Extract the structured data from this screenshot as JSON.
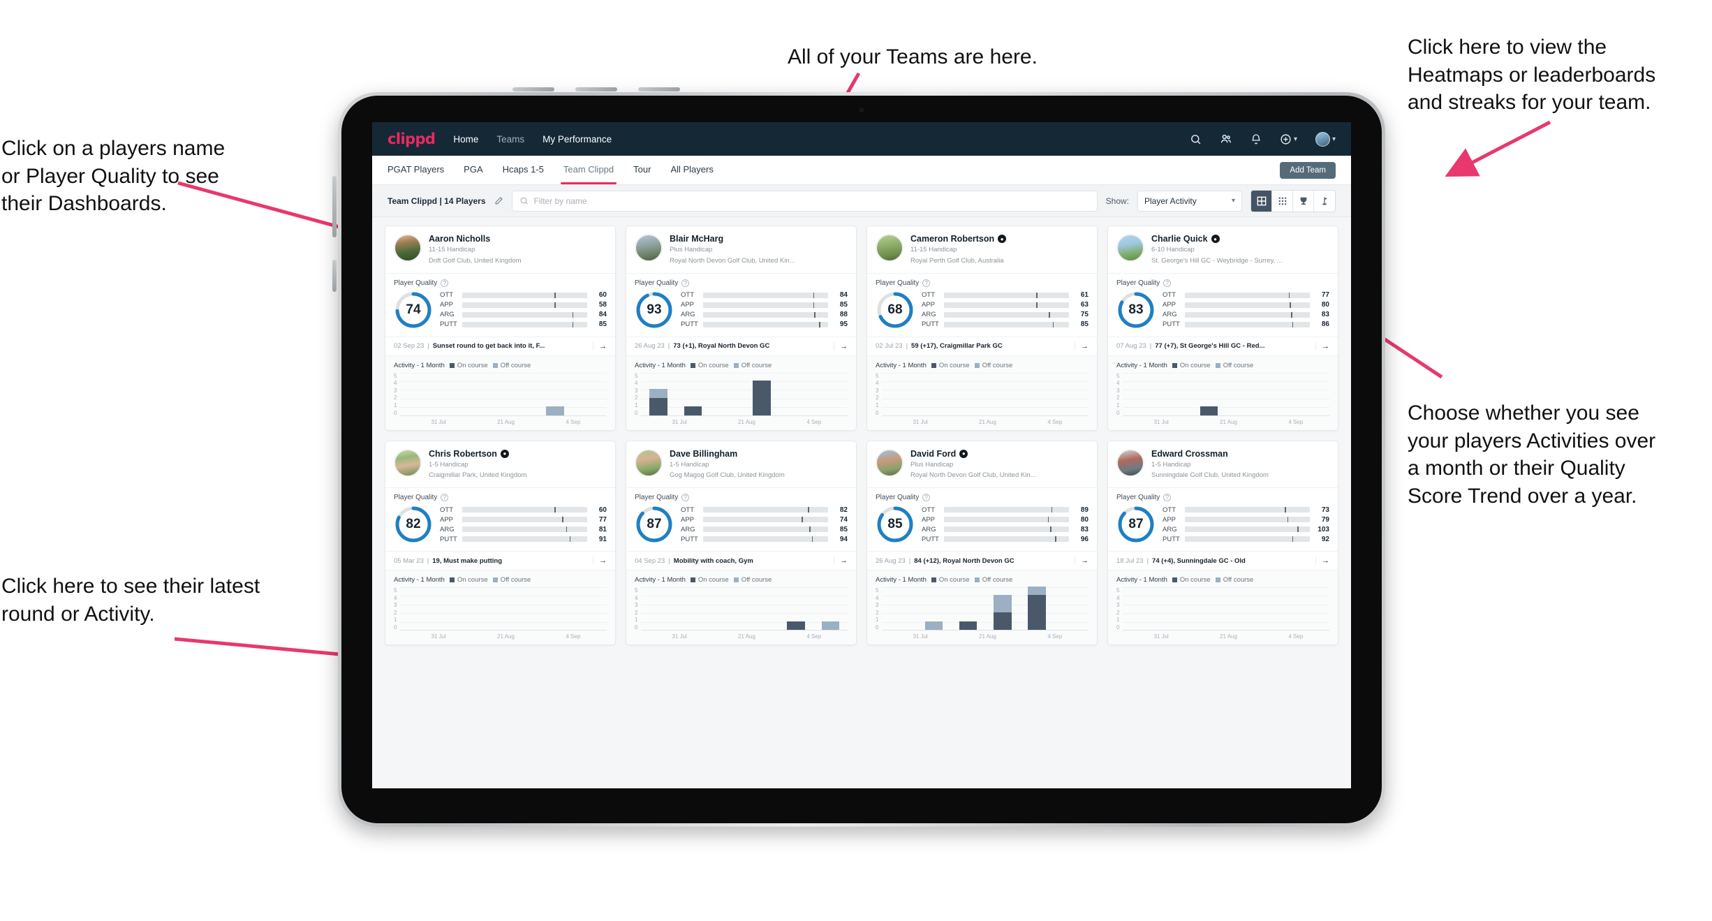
{
  "annotations": [
    {
      "id": "players-name",
      "text": "Click on a players name\nor Player Quality to see\ntheir Dashboards."
    },
    {
      "id": "teams-here",
      "text": "All of your Teams are here."
    },
    {
      "id": "heatmaps",
      "text": "Click here to view the\nHeatmaps or leaderboards\nand streaks for your team."
    },
    {
      "id": "choose-view",
      "text": "Choose whether you see\nyour players Activities over\na month or their Quality\nScore Trend over a year."
    },
    {
      "id": "latest-round",
      "text": "Click here to see their latest\nround or Activity."
    }
  ],
  "colors": {
    "brand_pink": "#ea2a5f",
    "navbar": "#152836",
    "ring_blue": "#1f7fc4",
    "ott": "#f5a800",
    "app": "#3ed6b0",
    "arg": "#f4145b",
    "putt": "#b400c8",
    "on_course": "#49596a",
    "off_course": "#9bb0c2"
  },
  "navbar": {
    "brand": "clippd",
    "links": [
      {
        "label": "Home",
        "active": true
      },
      {
        "label": "Teams",
        "active": false
      },
      {
        "label": "My Performance",
        "active": true
      }
    ],
    "icons": [
      "search-icon",
      "people-icon",
      "bell-icon",
      "plus-circle-icon",
      "avatar"
    ]
  },
  "tabs": {
    "items": [
      "PGAT Players",
      "PGA",
      "Hcaps 1-5",
      "Team Clippd",
      "Tour",
      "All Players"
    ],
    "active": "Team Clippd",
    "add_team_label": "Add Team"
  },
  "toolbar": {
    "team_label": "Team Clippd | 14 Players",
    "edit_icon": "pencil-icon",
    "search_placeholder": "Filter by name",
    "search_value": "",
    "show_label": "Show:",
    "show_value": "Player Activity",
    "show_options": [
      "Player Activity",
      "Quality Score Trend"
    ],
    "views": [
      {
        "name": "grid-view",
        "icon": "grid-icon",
        "active": true
      },
      {
        "name": "dense-grid-view",
        "icon": "dots-grid-icon",
        "active": false
      },
      {
        "name": "leaderboard-view",
        "icon": "trophy-icon",
        "active": false
      },
      {
        "name": "heatmap-view",
        "icon": "flag-icon",
        "active": false
      }
    ]
  },
  "card_labels": {
    "quality_title": "Player Quality",
    "help_icon": "question-icon",
    "activity_title": "Activity - 1 Month",
    "legend_on": "On course",
    "legend_off": "Off course",
    "go_icon": "arrow-right-icon",
    "bar_names": [
      "OTT",
      "APP",
      "ARG",
      "PUTT"
    ],
    "y_ticks": [
      "0",
      "1",
      "2",
      "3",
      "4",
      "5"
    ],
    "x_ticks": [
      "31 Jul",
      "21 Aug",
      "4 Sep"
    ]
  },
  "players": [
    {
      "name": "Aaron Nicholls",
      "verified": false,
      "handicap": "11-15 Handicap",
      "club": "Drift Golf Club, United Kingdom",
      "quality": 74,
      "bars": [
        {
          "label": "OTT",
          "value": 60,
          "fill": 56,
          "tick": 74
        },
        {
          "label": "APP",
          "value": 58,
          "fill": 52,
          "tick": 74
        },
        {
          "label": "ARG",
          "value": 84,
          "fill": 80,
          "tick": 88
        },
        {
          "label": "PUTT",
          "value": 85,
          "fill": 80,
          "tick": 88
        }
      ],
      "latest_date": "02 Sep 23",
      "latest_text": "Sunset round to get back into it, F...",
      "activity": [
        {
          "on": 0,
          "off": 0
        },
        {
          "on": 0,
          "off": 0
        },
        {
          "on": 0,
          "off": 0
        },
        {
          "on": 0,
          "off": 0
        },
        {
          "on": 0,
          "off": 1
        },
        {
          "on": 0,
          "off": 0
        }
      ]
    },
    {
      "name": "Blair McHarg",
      "verified": false,
      "handicap": "Plus Handicap",
      "club": "Royal North Devon Golf Club, United Kin...",
      "quality": 93,
      "bars": [
        {
          "label": "OTT",
          "value": 84,
          "fill": 80,
          "tick": 88
        },
        {
          "label": "APP",
          "value": 85,
          "fill": 80,
          "tick": 88
        },
        {
          "label": "ARG",
          "value": 88,
          "fill": 82,
          "tick": 89
        },
        {
          "label": "PUTT",
          "value": 95,
          "fill": 90,
          "tick": 93
        }
      ],
      "latest_date": "26 Aug 23",
      "latest_text": "73 (+1), Royal North Devon GC",
      "activity": [
        {
          "on": 2,
          "off": 1
        },
        {
          "on": 1,
          "off": 0
        },
        {
          "on": 0,
          "off": 0
        },
        {
          "on": 4,
          "off": 0
        },
        {
          "on": 0,
          "off": 0
        },
        {
          "on": 0,
          "off": 0
        }
      ]
    },
    {
      "name": "Cameron Robertson",
      "verified": true,
      "handicap": "11-15 Handicap",
      "club": "Royal Perth Golf Club, Australia",
      "quality": 68,
      "bars": [
        {
          "label": "OTT",
          "value": 61,
          "fill": 56,
          "tick": 74
        },
        {
          "label": "APP",
          "value": 63,
          "fill": 52,
          "tick": 74
        },
        {
          "label": "ARG",
          "value": 75,
          "fill": 72,
          "tick": 84
        },
        {
          "label": "PUTT",
          "value": 85,
          "fill": 79,
          "tick": 87
        }
      ],
      "latest_date": "02 Jul 23",
      "latest_text": "59 (+17), Craigmillar Park GC",
      "activity": [
        {
          "on": 0,
          "off": 0
        },
        {
          "on": 0,
          "off": 0
        },
        {
          "on": 0,
          "off": 0
        },
        {
          "on": 0,
          "off": 0
        },
        {
          "on": 0,
          "off": 0
        },
        {
          "on": 0,
          "off": 0
        }
      ]
    },
    {
      "name": "Charlie Quick",
      "verified": true,
      "handicap": "6-10 Handicap",
      "club": "St. George's Hill GC - Weybridge - Surrey, ...",
      "quality": 83,
      "bars": [
        {
          "label": "OTT",
          "value": 77,
          "fill": 69,
          "tick": 83
        },
        {
          "label": "APP",
          "value": 80,
          "fill": 70,
          "tick": 84
        },
        {
          "label": "ARG",
          "value": 83,
          "fill": 72,
          "tick": 85
        },
        {
          "label": "PUTT",
          "value": 86,
          "fill": 73,
          "tick": 86
        }
      ],
      "latest_date": "07 Aug 23",
      "latest_text": "77 (+7), St George's Hill GC - Red...",
      "activity": [
        {
          "on": 0,
          "off": 0
        },
        {
          "on": 0,
          "off": 0
        },
        {
          "on": 1,
          "off": 0
        },
        {
          "on": 0,
          "off": 0
        },
        {
          "on": 0,
          "off": 0
        },
        {
          "on": 0,
          "off": 0
        }
      ]
    },
    {
      "name": "Chris Robertson",
      "verified": true,
      "handicap": "1-5 Handicap",
      "club": "Craigmillar Park, United Kingdom",
      "quality": 82,
      "bars": [
        {
          "label": "OTT",
          "value": 60,
          "fill": 56,
          "tick": 74
        },
        {
          "label": "APP",
          "value": 77,
          "fill": 67,
          "tick": 80
        },
        {
          "label": "ARG",
          "value": 81,
          "fill": 70,
          "tick": 83
        },
        {
          "label": "PUTT",
          "value": 91,
          "fill": 79,
          "tick": 86
        }
      ],
      "latest_date": "05 Mar 23",
      "latest_text": "19, Must make putting",
      "activity": [
        {
          "on": 0,
          "off": 0
        },
        {
          "on": 0,
          "off": 0
        },
        {
          "on": 0,
          "off": 0
        },
        {
          "on": 0,
          "off": 0
        },
        {
          "on": 0,
          "off": 0
        },
        {
          "on": 0,
          "off": 0
        }
      ]
    },
    {
      "name": "Dave Billingham",
      "verified": false,
      "handicap": "1-5 Handicap",
      "club": "Gog Magog Golf Club, United Kingdom",
      "quality": 87,
      "bars": [
        {
          "label": "OTT",
          "value": 82,
          "fill": 72,
          "tick": 84
        },
        {
          "label": "APP",
          "value": 74,
          "fill": 64,
          "tick": 79
        },
        {
          "label": "ARG",
          "value": 85,
          "fill": 72,
          "tick": 85
        },
        {
          "label": "PUTT",
          "value": 94,
          "fill": 81,
          "tick": 87
        }
      ],
      "latest_date": "04 Sep 23",
      "latest_text": "Mobility with coach, Gym",
      "activity": [
        {
          "on": 0,
          "off": 0
        },
        {
          "on": 0,
          "off": 0
        },
        {
          "on": 0,
          "off": 0
        },
        {
          "on": 0,
          "off": 0
        },
        {
          "on": 1,
          "off": 0
        },
        {
          "on": 0,
          "off": 1
        }
      ]
    },
    {
      "name": "David Ford",
      "verified": true,
      "handicap": "Plus Handicap",
      "club": "Royal North Devon Golf Club, United Kin...",
      "quality": 85,
      "bars": [
        {
          "label": "OTT",
          "value": 89,
          "fill": 79,
          "tick": 86
        },
        {
          "label": "APP",
          "value": 80,
          "fill": 70,
          "tick": 83
        },
        {
          "label": "ARG",
          "value": 83,
          "fill": 72,
          "tick": 85
        },
        {
          "label": "PUTT",
          "value": 96,
          "fill": 84,
          "tick": 89
        }
      ],
      "latest_date": "26 Aug 23",
      "latest_text": "84 (+12), Royal North Devon GC",
      "activity": [
        {
          "on": 0,
          "off": 0
        },
        {
          "on": 0,
          "off": 1
        },
        {
          "on": 1,
          "off": 0
        },
        {
          "on": 2,
          "off": 2
        },
        {
          "on": 4,
          "off": 1
        },
        {
          "on": 0,
          "off": 0
        }
      ]
    },
    {
      "name": "Edward Crossman",
      "verified": false,
      "handicap": "1-5 Handicap",
      "club": "Sunningdale Golf Club, United Kingdom",
      "quality": 87,
      "bars": [
        {
          "label": "OTT",
          "value": 73,
          "fill": 63,
          "tick": 80
        },
        {
          "label": "APP",
          "value": 79,
          "fill": 68,
          "tick": 82
        },
        {
          "label": "ARG",
          "value": 103,
          "fill": 83,
          "tick": 90
        },
        {
          "label": "PUTT",
          "value": 92,
          "fill": 79,
          "tick": 86
        }
      ],
      "latest_date": "18 Jul 23",
      "latest_text": "74 (+4), Sunningdale GC - Old",
      "activity": [
        {
          "on": 0,
          "off": 0
        },
        {
          "on": 0,
          "off": 0
        },
        {
          "on": 0,
          "off": 0
        },
        {
          "on": 0,
          "off": 0
        },
        {
          "on": 0,
          "off": 0
        },
        {
          "on": 0,
          "off": 0
        }
      ]
    }
  ]
}
